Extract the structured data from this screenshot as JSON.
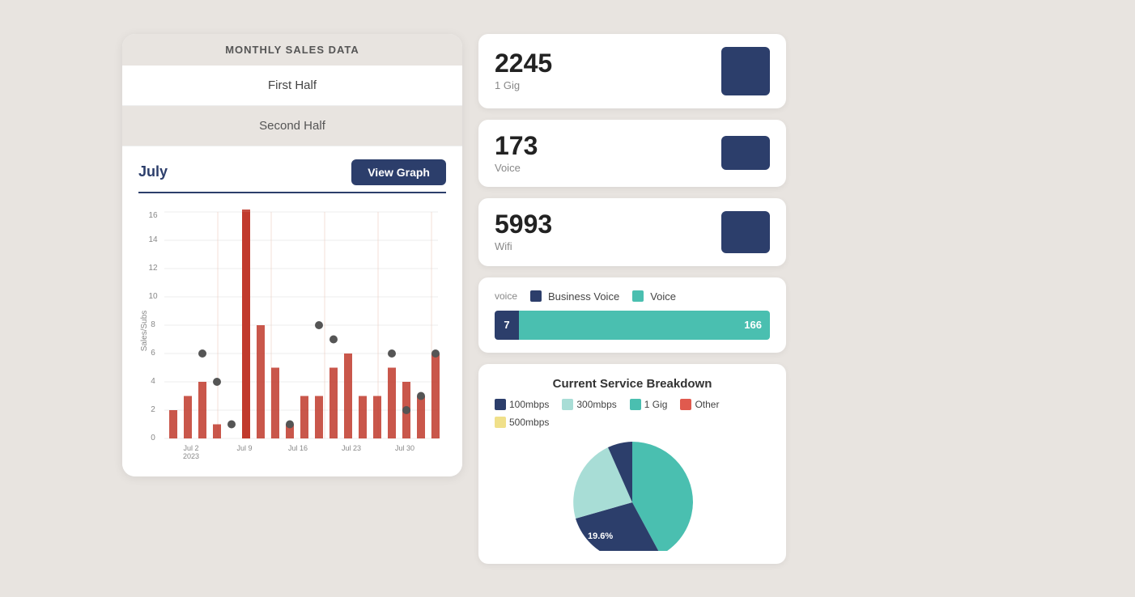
{
  "leftPanel": {
    "title": "MONTHLY SALES DATA",
    "firstHalfLabel": "First Half",
    "secondHalfLabel": "Second Half",
    "chart": {
      "month": "July",
      "viewGraphLabel": "View Graph",
      "yAxisMax": 16,
      "yAxisLabels": [
        0,
        2,
        4,
        6,
        8,
        10,
        12,
        14,
        16
      ],
      "xAxisLabels": [
        "Jul 2\n2023",
        "Jul 9",
        "Jul 16",
        "Jul 23",
        "Jul 30"
      ],
      "barData": [
        2,
        3,
        4,
        1,
        0,
        17,
        8,
        5,
        1,
        3,
        3,
        5,
        6,
        3,
        3,
        5,
        4,
        3,
        6
      ],
      "dotData": [
        0,
        0,
        6,
        4,
        1,
        0,
        0,
        0,
        1,
        0,
        8,
        7,
        0,
        0,
        0,
        6,
        2,
        3,
        6
      ]
    }
  },
  "rightPanel": {
    "stats": [
      {
        "id": "gig",
        "number": "2245",
        "label": "1 Gig",
        "barHeight": 60
      },
      {
        "id": "voice",
        "number": "173",
        "label": "Voice",
        "barHeight": 42
      },
      {
        "id": "wifi",
        "number": "5993",
        "label": "Wifi",
        "barHeight": 52
      }
    ],
    "voiceBreakdown": {
      "title": "voice",
      "legends": [
        {
          "label": "Business Voice",
          "color": "#2c3e6b"
        },
        {
          "label": "Voice",
          "color": "#4abfb0"
        }
      ],
      "businessValue": 7,
      "voiceValue": 166
    },
    "serviceBreakdown": {
      "title": "Current Service Breakdown",
      "legends": [
        {
          "label": "100mbps",
          "color": "#2c3e6b"
        },
        {
          "label": "300mbps",
          "color": "#a8ddd6"
        },
        {
          "label": "1 Gig",
          "color": "#4abfb0"
        },
        {
          "label": "Other",
          "color": "#e05a4e"
        },
        {
          "label": "500mbps",
          "color": "#f0e08a"
        }
      ],
      "pieLabel": "19.6%"
    }
  }
}
